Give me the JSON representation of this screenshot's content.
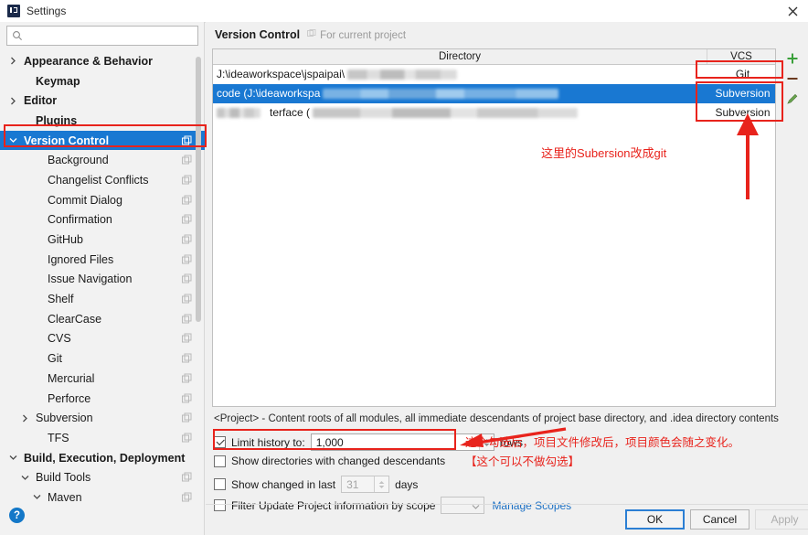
{
  "window": {
    "title": "Settings",
    "app_icon": "intellij-idea-icon",
    "close_icon": "close-icon"
  },
  "sidebar": {
    "search": {
      "value": "",
      "placeholder": "",
      "icon": "search-icon"
    },
    "items": [
      {
        "label": "Appearance & Behavior",
        "indent": 0,
        "twisty": "right",
        "bold": true,
        "config": false,
        "selected": false
      },
      {
        "label": "Keymap",
        "indent": 1,
        "twisty": "none",
        "bold": true,
        "config": false,
        "selected": false
      },
      {
        "label": "Editor",
        "indent": 0,
        "twisty": "right",
        "bold": true,
        "config": false,
        "selected": false
      },
      {
        "label": "Plugins",
        "indent": 1,
        "twisty": "none",
        "bold": true,
        "config": false,
        "selected": false
      },
      {
        "label": "Version Control",
        "indent": 0,
        "twisty": "down",
        "bold": true,
        "config": true,
        "selected": true
      },
      {
        "label": "Background",
        "indent": 2,
        "twisty": "none",
        "bold": false,
        "config": true,
        "selected": false
      },
      {
        "label": "Changelist Conflicts",
        "indent": 2,
        "twisty": "none",
        "bold": false,
        "config": true,
        "selected": false
      },
      {
        "label": "Commit Dialog",
        "indent": 2,
        "twisty": "none",
        "bold": false,
        "config": true,
        "selected": false
      },
      {
        "label": "Confirmation",
        "indent": 2,
        "twisty": "none",
        "bold": false,
        "config": true,
        "selected": false
      },
      {
        "label": "GitHub",
        "indent": 2,
        "twisty": "none",
        "bold": false,
        "config": true,
        "selected": false
      },
      {
        "label": "Ignored Files",
        "indent": 2,
        "twisty": "none",
        "bold": false,
        "config": true,
        "selected": false
      },
      {
        "label": "Issue Navigation",
        "indent": 2,
        "twisty": "none",
        "bold": false,
        "config": true,
        "selected": false
      },
      {
        "label": "Shelf",
        "indent": 2,
        "twisty": "none",
        "bold": false,
        "config": true,
        "selected": false
      },
      {
        "label": "ClearCase",
        "indent": 2,
        "twisty": "none",
        "bold": false,
        "config": true,
        "selected": false
      },
      {
        "label": "CVS",
        "indent": 2,
        "twisty": "none",
        "bold": false,
        "config": true,
        "selected": false
      },
      {
        "label": "Git",
        "indent": 2,
        "twisty": "none",
        "bold": false,
        "config": true,
        "selected": false
      },
      {
        "label": "Mercurial",
        "indent": 2,
        "twisty": "none",
        "bold": false,
        "config": true,
        "selected": false
      },
      {
        "label": "Perforce",
        "indent": 2,
        "twisty": "none",
        "bold": false,
        "config": true,
        "selected": false
      },
      {
        "label": "Subversion",
        "indent": 1,
        "twisty": "right",
        "bold": false,
        "config": true,
        "selected": false
      },
      {
        "label": "TFS",
        "indent": 2,
        "twisty": "none",
        "bold": false,
        "config": true,
        "selected": false
      },
      {
        "label": "Build, Execution, Deployment",
        "indent": 0,
        "twisty": "down",
        "bold": true,
        "config": false,
        "selected": false
      },
      {
        "label": "Build Tools",
        "indent": 1,
        "twisty": "down",
        "bold": false,
        "config": true,
        "selected": false
      },
      {
        "label": "Maven",
        "indent": 2,
        "twisty": "down",
        "bold": false,
        "config": true,
        "selected": false
      }
    ],
    "help_label": "?"
  },
  "panel": {
    "title": "Version Control",
    "subtitle": "For current project",
    "subtitle_icon": "project-scope-icon"
  },
  "table": {
    "columns": [
      "Directory",
      "VCS"
    ],
    "rows": [
      {
        "directory": "J:\\ideaworkspace\\jspaipai\\",
        "redacted": true,
        "redact_width": 120,
        "vcs": "Git",
        "selected": false
      },
      {
        "directory": "code (J:\\ideaworkspa",
        "redacted": true,
        "redact_width": 258,
        "vcs": "Subversion",
        "selected": true
      },
      {
        "directory": "terface (",
        "redacted": true,
        "redact_width": 290,
        "vcs": "Subversion",
        "selected": false
      }
    ]
  },
  "tools": [
    {
      "name": "add-button",
      "glyph": "+",
      "color": "#3aa03a"
    },
    {
      "name": "remove-button",
      "glyph": "−",
      "color": "#6b3a1f"
    },
    {
      "name": "edit-button",
      "glyph": "✎",
      "color": "#6aa84f"
    }
  ],
  "options": {
    "project_description": "<Project> - Content roots of all modules, all immediate descendants of project base directory, and .idea directory contents",
    "limit_history": {
      "label": "Limit history to:",
      "checked": true,
      "value": "1,000",
      "suffix": "rows"
    },
    "show_directories": {
      "label": "Show directories with changed descendants",
      "checked": false
    },
    "show_changed": {
      "label": "Show changed in last",
      "checked": false,
      "value": "31",
      "suffix": "days",
      "disabled": true
    },
    "filter_scope": {
      "label": "Filter Update Project information by scope",
      "checked": false,
      "combo_value": "",
      "link": "Manage Scopes"
    }
  },
  "buttons": {
    "ok": "OK",
    "cancel": "Cancel",
    "apply": "Apply"
  },
  "annotations": {
    "note_vcs": "这里的Subersion改成git",
    "note_checkbox_line1": "这个勾选后，项目文件修改后，项目颜色会随之变化。",
    "note_checkbox_line2": "【这个可以不做勾选】",
    "color": "#e8231c"
  }
}
